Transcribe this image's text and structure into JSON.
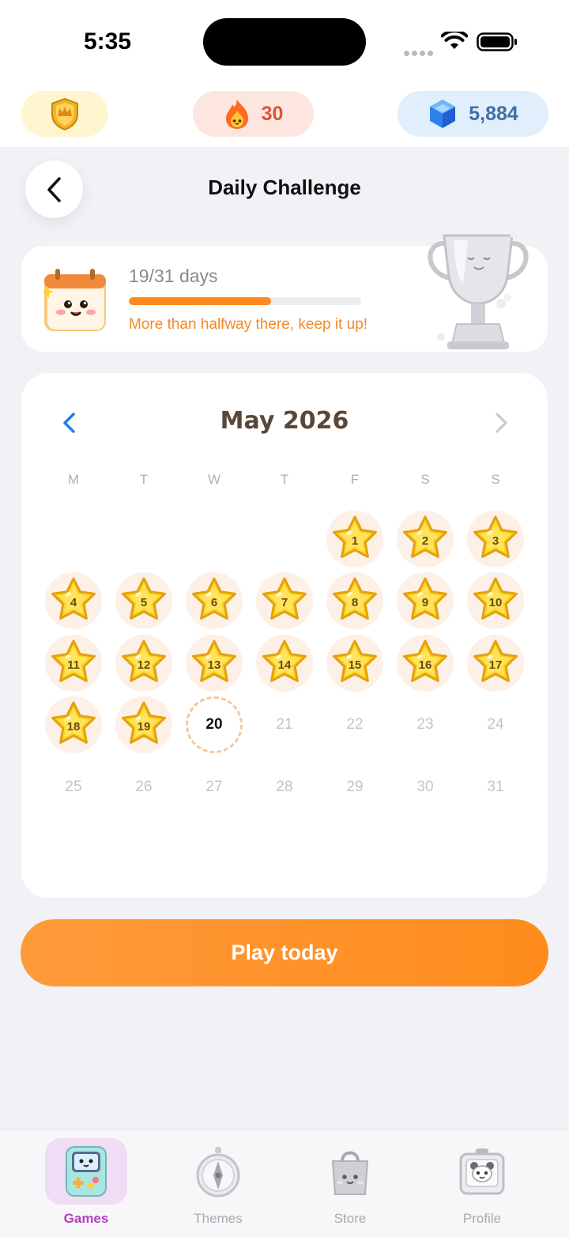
{
  "status_bar": {
    "time": "5:35"
  },
  "top_bar": {
    "streak_count": "30",
    "gems_count": "5,884"
  },
  "header": {
    "title": "Daily Challenge"
  },
  "progress": {
    "days_label": "19/31 days",
    "completed": 19,
    "total": 31,
    "message": "More than halfway there, keep it up!"
  },
  "calendar": {
    "month_label": "May 2026",
    "weekdays": [
      "M",
      "T",
      "W",
      "T",
      "F",
      "S",
      "S"
    ],
    "first_weekday_index": 4,
    "days_in_month": 31,
    "completed_days": [
      1,
      2,
      3,
      4,
      5,
      6,
      7,
      8,
      9,
      10,
      11,
      12,
      13,
      14,
      15,
      16,
      17,
      18,
      19
    ],
    "today": 20
  },
  "actions": {
    "play_label": "Play today"
  },
  "tabbar": {
    "items": [
      {
        "label": "Games",
        "icon": "gameboy-icon",
        "active": true
      },
      {
        "label": "Themes",
        "icon": "compass-icon",
        "active": false
      },
      {
        "label": "Store",
        "icon": "shopping-bag-icon",
        "active": false
      },
      {
        "label": "Profile",
        "icon": "id-badge-icon",
        "active": false
      }
    ]
  },
  "colors": {
    "accent": "#ff8c1c",
    "star": "#ffd21f",
    "tab_active": "#b43bc4"
  }
}
